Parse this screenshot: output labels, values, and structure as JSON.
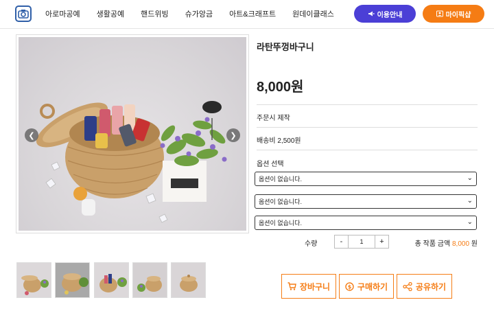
{
  "header": {
    "nav": [
      "아로마공예",
      "생활공예",
      "핸드위빙",
      "슈가앙금",
      "아트&크래프트",
      "원데이클래스"
    ],
    "guide_label": "이용안내",
    "mypage_label": "마이픽샵",
    "brand_color": "#4b3fd6",
    "accent_color": "#f57c14"
  },
  "product": {
    "title": "라탄뚜껑바구니",
    "price": "8,000원",
    "made_to_order": "주문시 제작",
    "shipping": "배송비 2,500원",
    "option_label": "옵션 선택",
    "options": [
      "옵션이 없습니다.",
      "옵션이 없습니다.",
      "옵션이 없습니다."
    ],
    "qty_label": "수량",
    "qty_minus": "-",
    "qty_value": "1",
    "qty_plus": "+",
    "total_label": "총 작품 금액",
    "total_amount": "8,000",
    "total_unit": "원"
  },
  "actions": {
    "cart": "장바구니",
    "buy": "구매하기",
    "share": "공유하기"
  },
  "icons": {
    "prev": "chevron-left-icon",
    "next": "chevron-right-icon"
  }
}
